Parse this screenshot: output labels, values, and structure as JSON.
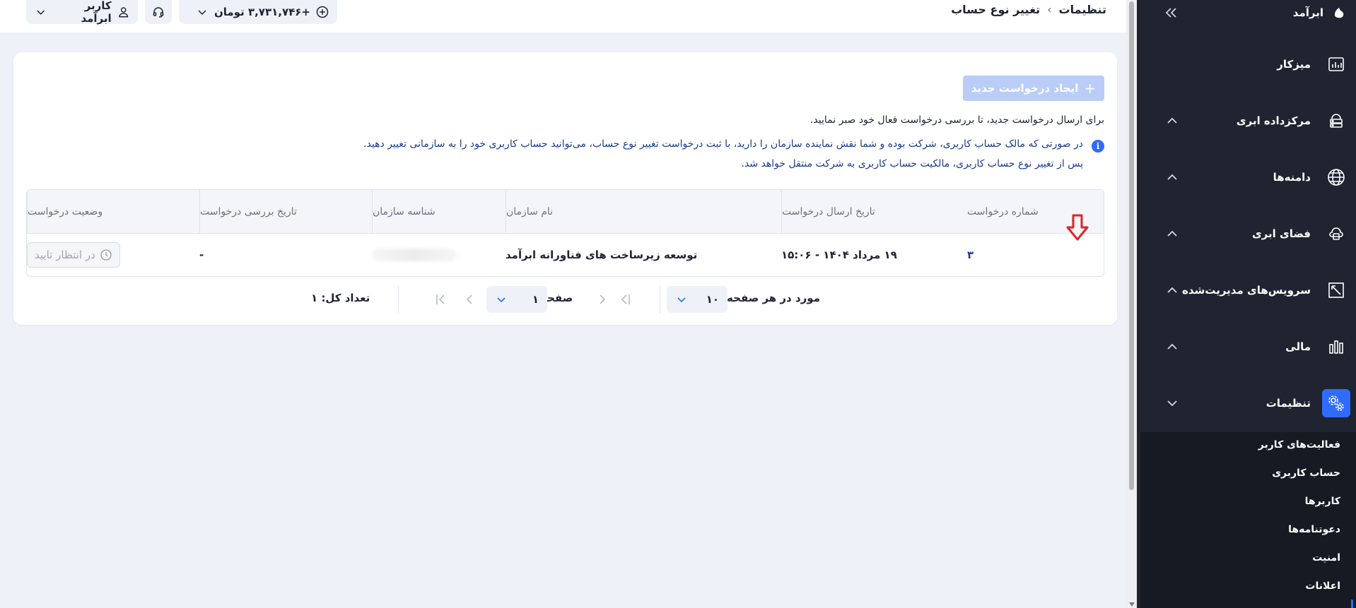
{
  "sidebar": {
    "brand": "ابرآمد",
    "items": [
      {
        "label": "میزکار",
        "icon": "chart-board-icon"
      },
      {
        "label": "مرکزداده ابری",
        "icon": "datacenter-icon"
      },
      {
        "label": "دامنه‌ها",
        "icon": "globe-icon"
      },
      {
        "label": "فضای ابری",
        "icon": "cloud-space-icon"
      },
      {
        "label": "سرویس‌های مدیریت‌شده",
        "icon": "managed-services-icon"
      },
      {
        "label": "مالی",
        "icon": "finance-icon"
      },
      {
        "label": "تنظیمات",
        "icon": "settings-gears-icon"
      }
    ],
    "submenu": [
      "فعالیت‌های کاربر",
      "حساب کاربری",
      "کاربرها",
      "دعوتنامه‌ها",
      "امنیت",
      "اعلانات"
    ]
  },
  "topbar": {
    "breadcrumb_parent": "تنظیمات",
    "breadcrumb_current": "تغییر نوع حساب",
    "balance": "+۳,۷۳۱,۷۴۶ تومان",
    "user_name": "کاربر ابرآمد"
  },
  "main": {
    "create_button": "ایجاد درخواست جدید",
    "note": "برای ارسال درخواست جدید، تا بررسی درخواست فعال خود صبر نمایید.",
    "info_line1": "در صورتی که مالک حساب کاربری، شرکت بوده و شما نقش نماینده سازمان را دارید، با ثبت درخواست تغییر نوع حساب، می‌توانید حساب کاربری خود را به سازمانی تغییر دهید.",
    "info_line2": "پس از تغییر نوع حساب کاربری، مالکیت حساب کاربری به شرکت منتقل خواهد شد.",
    "table": {
      "columns": [
        "شماره درخواست",
        "تاریخ ارسال درخواست",
        "نام سازمان",
        "شناسه سازمان",
        "تاریخ بررسی درخواست",
        "وضعیت درخواست"
      ],
      "rows": [
        {
          "number": "۳",
          "sent_date": "۱۹ مرداد ۱۴۰۴ - ۱۵:۰۶",
          "org_name": "توسعه زیرساخت های فناورانه ابرآمد",
          "org_id": "",
          "review_date": "-",
          "status": "در انتظار تایید"
        }
      ]
    },
    "pagination": {
      "per_page_label": "مورد در هر صفحه:",
      "per_page_value": "۱۰",
      "page_label": "صفحه",
      "page_value": "۱",
      "total_label": "تعداد کل: ۱"
    }
  },
  "colors": {
    "accent": "#2f6bff",
    "sidebar_bg": "#1f2430",
    "highlight_arrow": "#e02424"
  }
}
